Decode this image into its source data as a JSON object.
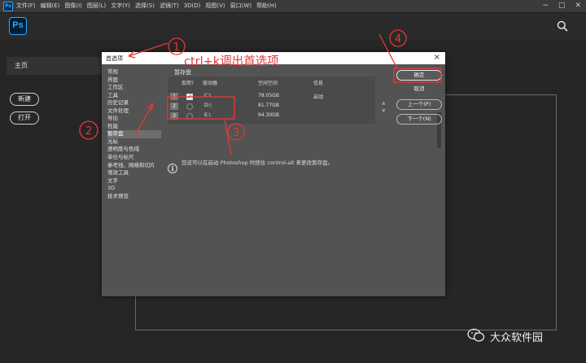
{
  "menubar": {
    "app_icon": "Ps",
    "items": [
      "文件(F)",
      "编辑(E)",
      "图像(I)",
      "图层(L)",
      "文字(Y)",
      "选择(S)",
      "滤镜(T)",
      "3D(D)",
      "视图(V)",
      "窗口(W)",
      "帮助(H)"
    ],
    "window_controls": [
      "−",
      "□",
      "✕"
    ]
  },
  "header": {
    "logo": "Ps",
    "search_icon": "search-icon"
  },
  "home": {
    "tab_label": "主页",
    "new_button": "新建",
    "open_button": "打开"
  },
  "dialog": {
    "title": "首选项",
    "close": "×",
    "categories": [
      "常规",
      "界面",
      "工作区",
      "工具",
      "历史记录",
      "文件处理",
      "导出",
      "性能",
      "暂存盘",
      "光标",
      "透明度与色域",
      "单位与标尺",
      "参考线、网格和切片",
      "增效工具",
      "文字",
      "3D",
      "技术预览"
    ],
    "selected_category_index": 8,
    "section_title": "暂存盘",
    "table": {
      "headers": [
        "现用?",
        "驱动器",
        "空闲空间",
        "信息"
      ],
      "rows": [
        {
          "num": "1",
          "checked": true,
          "check_mark": "✓",
          "drive": "C:\\",
          "free": "78.05GB",
          "info": "启动"
        },
        {
          "num": "2",
          "checked": false,
          "check_mark": "",
          "drive": "D:\\",
          "free": "81.77GB",
          "info": ""
        },
        {
          "num": "3",
          "checked": false,
          "check_mark": "",
          "drive": "E:\\",
          "free": "94.30GB",
          "info": ""
        }
      ]
    },
    "reorder_arrows": [
      "▲",
      "▼"
    ],
    "note_icon": "info-icon",
    "note_glyph": "i",
    "note": "您还可以在启动 Photoshop 时按住 control-alt 来更改暂存盘。",
    "buttons": {
      "ok": "确定",
      "cancel": "取消",
      "prev": "上一个(P)",
      "next": "下一个(N)"
    }
  },
  "annotations": {
    "color": "#e53935",
    "caption": "ctrl+k调出首选项",
    "markers": [
      "1",
      "2",
      "3",
      "4"
    ]
  },
  "watermark": {
    "icon": "wechat-icon",
    "text": "大众软件园"
  }
}
